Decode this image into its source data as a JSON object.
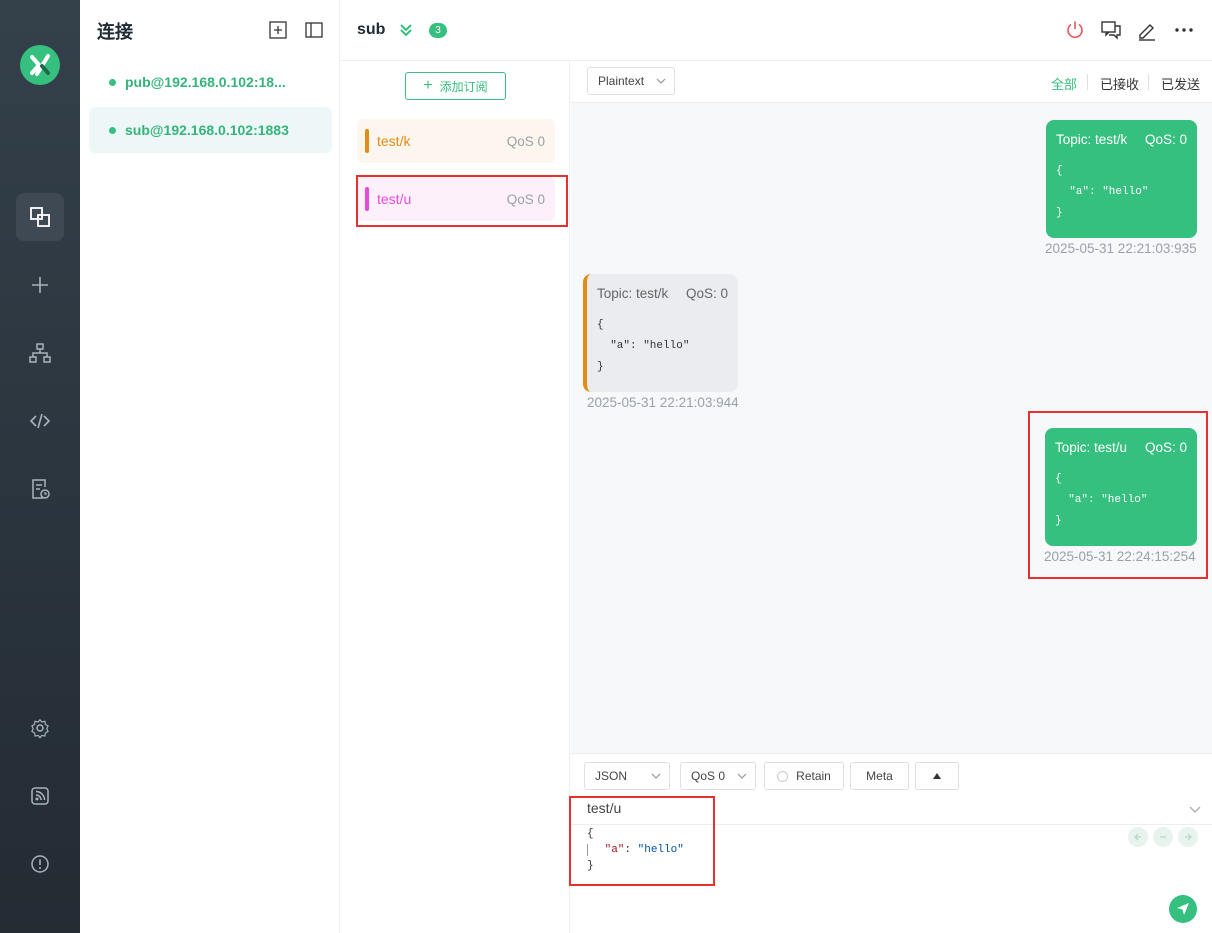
{
  "connections": {
    "title": "连接",
    "items": [
      {
        "name": "pub@192.168.0.102:18...",
        "active": false
      },
      {
        "name": "sub@192.168.0.102:1883",
        "active": true
      }
    ]
  },
  "header": {
    "title": "sub",
    "message_count": "3"
  },
  "subscriptions": {
    "add_label": "添加订阅",
    "items": [
      {
        "topic": "test/k",
        "qos": "QoS 0",
        "color": "#e38c14",
        "bg": "#fdf6ee"
      },
      {
        "topic": "test/u",
        "qos": "QoS 0",
        "color": "#e84ad8",
        "bg": "#fdf0fb"
      }
    ]
  },
  "message_toolbar": {
    "format": "Plaintext",
    "filters": [
      "全部",
      "已接收",
      "已发送"
    ]
  },
  "messages": [
    {
      "direction": "sent",
      "topic_label": "Topic: test/k",
      "qos_label": "QoS: 0",
      "payload": "{\n  \"a\": \"hello\"\n}",
      "timestamp": "2025-05-31 22:21:03:935"
    },
    {
      "direction": "received",
      "topic_label": "Topic: test/k",
      "qos_label": "QoS: 0",
      "payload": "{\n  \"a\": \"hello\"\n}",
      "timestamp": "2025-05-31 22:21:03:944",
      "color": "#e38c14"
    },
    {
      "direction": "sent",
      "topic_label": "Topic: test/u",
      "qos_label": "QoS: 0",
      "payload": "{\n  \"a\": \"hello\"\n}",
      "timestamp": "2025-05-31 22:24:15:254"
    }
  ],
  "publish": {
    "format": "JSON",
    "qos": "QoS 0",
    "retain_label": "Retain",
    "meta_label": "Meta",
    "topic": "test/u",
    "payload": {
      "open": "{",
      "key": "\"a\"",
      "colon": ": ",
      "value": "\"hello\"",
      "close": "}"
    }
  }
}
